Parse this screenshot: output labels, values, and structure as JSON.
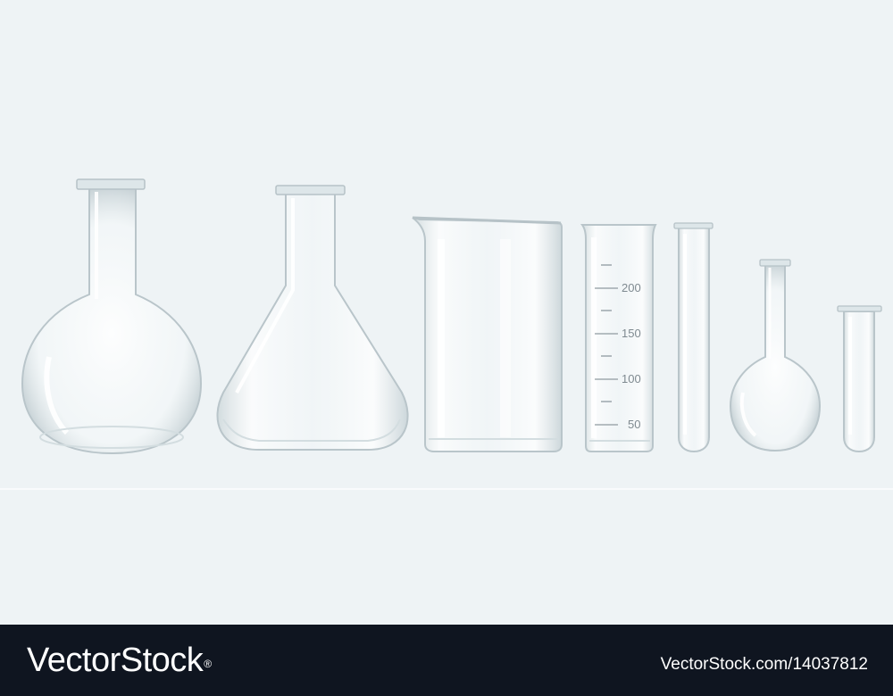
{
  "scene": {
    "background_color": "#eef3f5",
    "glass_color": "#ffffff",
    "items": [
      {
        "name": "round-bottom-flask",
        "kind": "icon"
      },
      {
        "name": "erlenmeyer-flask",
        "kind": "icon"
      },
      {
        "name": "beaker",
        "kind": "icon"
      },
      {
        "name": "graduated-cylinder",
        "kind": "icon"
      },
      {
        "name": "test-tube",
        "kind": "icon"
      },
      {
        "name": "small-round-bottom-flask",
        "kind": "icon"
      },
      {
        "name": "short-test-tube",
        "kind": "icon"
      }
    ],
    "cylinder_scale": [
      "200",
      "150",
      "100",
      "50"
    ]
  },
  "footer": {
    "background_color": "#0f1520",
    "logo_text": "VectorStock",
    "logo_mark": "®",
    "image_id": "VectorStock.com/14037812"
  }
}
